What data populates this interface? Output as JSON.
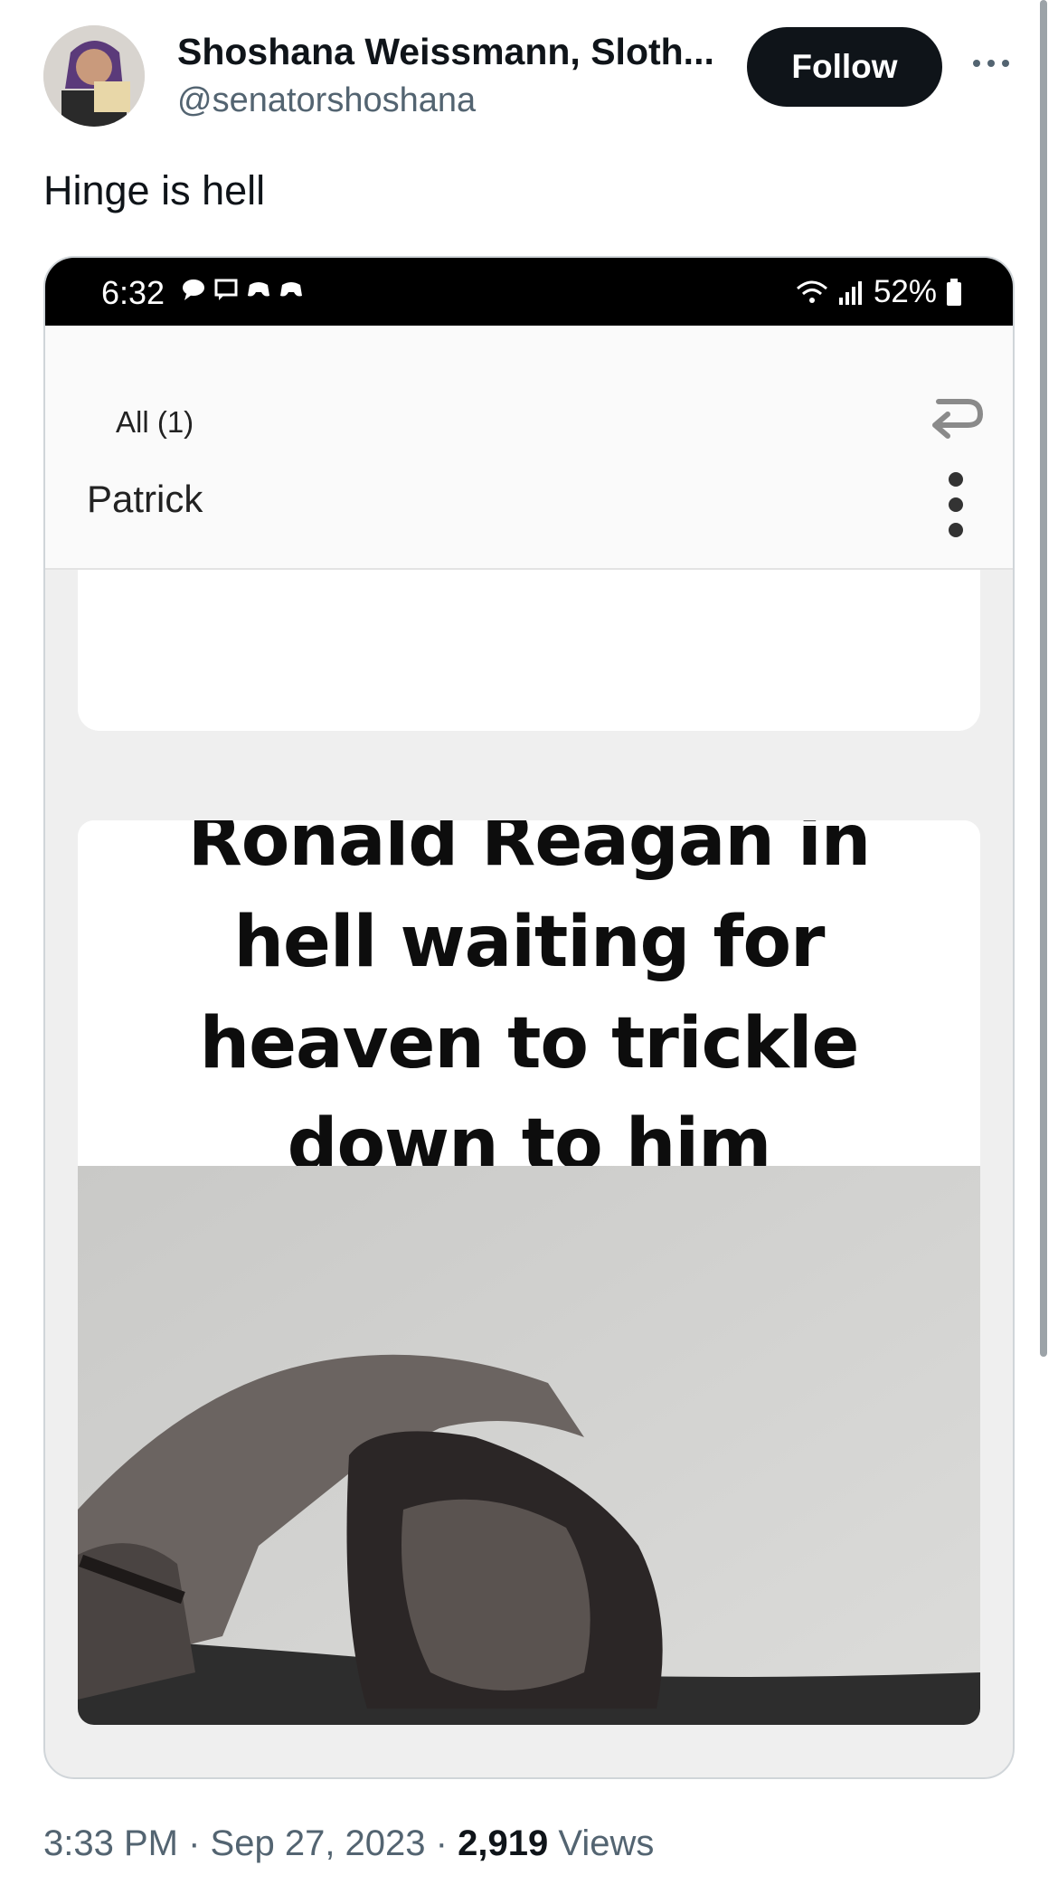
{
  "author": {
    "display_name": "Shoshana Weissmann, Sloth...",
    "handle": "@senatorshoshana",
    "avatar_icon": "avatar"
  },
  "follow_label": "Follow",
  "tweet_text": "Hinge is hell",
  "phone_status": {
    "time": "6:32",
    "battery": "52%"
  },
  "app_header": {
    "filter": "All (1)",
    "contact": "Patrick"
  },
  "meme": {
    "caption": "Ronald Reagan in hell waiting for heaven to trickle down to him"
  },
  "footer": {
    "time": "3:33 PM",
    "separator": "·",
    "date": "Sep 27, 2023",
    "views_count": "2,919",
    "views_label": "Views"
  },
  "colors": {
    "follow_button": "#0f1419",
    "secondary_text": "#536471"
  }
}
